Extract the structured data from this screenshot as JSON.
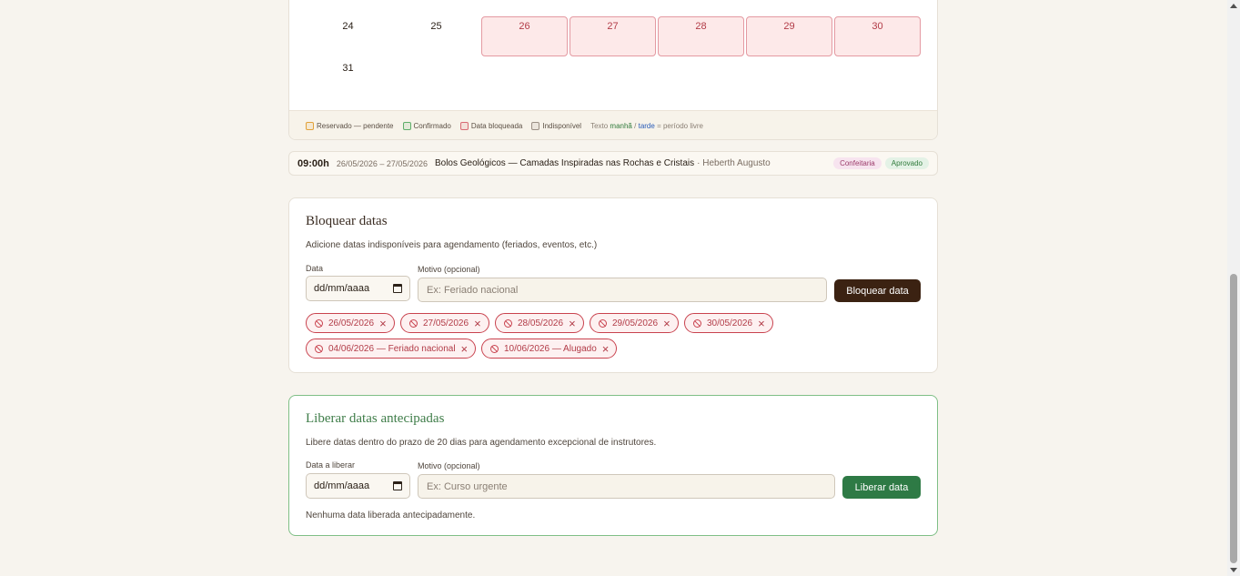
{
  "calendar": {
    "days_row1": [
      {
        "label": "24",
        "blocked": false
      },
      {
        "label": "25",
        "blocked": false
      },
      {
        "label": "26",
        "blocked": true
      },
      {
        "label": "27",
        "blocked": true
      },
      {
        "label": "28",
        "blocked": true
      },
      {
        "label": "29",
        "blocked": true
      },
      {
        "label": "30",
        "blocked": true
      }
    ],
    "days_row2": [
      {
        "label": "31",
        "blocked": false
      }
    ],
    "legend": {
      "pending": "Reservado — pendente",
      "confirmed": "Confirmado",
      "blocked": "Data bloqueada",
      "unavailable": "Indisponível",
      "text_label": "Texto",
      "morning": "manhã",
      "separator": "/",
      "afternoon": "tarde",
      "free_period": "= período livre"
    },
    "colors": {
      "pending": "#e2a23a",
      "confirmed": "#5fae6a",
      "blocked": "#d86a73",
      "unavailable": "#9a8f84"
    }
  },
  "event": {
    "time": "09:00h",
    "dates": "26/05/2026 – 27/05/2026",
    "title": "Bolos Geológicos — Camadas Inspiradas nas Rochas e Cristais",
    "person": "· Heberth Augusto",
    "category": "Confeitaria",
    "status": "Aprovado"
  },
  "block_dates": {
    "title": "Bloquear datas",
    "description": "Adicione datas indisponíveis para agendamento (feriados, eventos, etc.)",
    "date_label": "Data",
    "date_value": "dd/mm/aaaa",
    "reason_label": "Motivo (opcional)",
    "reason_placeholder": "Ex: Feriado nacional",
    "button": "Bloquear data",
    "chips": [
      "26/05/2026",
      "27/05/2026",
      "28/05/2026",
      "29/05/2026",
      "30/05/2026",
      "04/06/2026 — Feriado nacional",
      "10/06/2026 — Alugado"
    ],
    "remove_symbol": "×"
  },
  "release_dates": {
    "title": "Liberar datas antecipadas",
    "description": "Libere datas dentro do prazo de 20 dias para agendamento excepcional de instrutores.",
    "date_label": "Data a liberar",
    "date_value": "dd/mm/aaaa",
    "reason_label": "Motivo (opcional)",
    "reason_placeholder": "Ex: Curso urgente",
    "button": "Liberar data",
    "empty_message": "Nenhuma data liberada antecipadamente."
  }
}
